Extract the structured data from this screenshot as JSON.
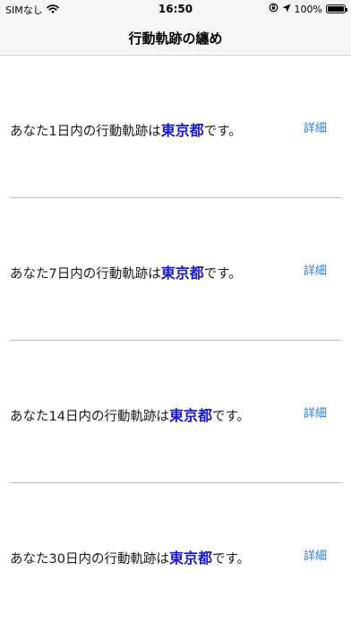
{
  "status_bar": {
    "carrier": "SIMなし",
    "time": "16:50",
    "battery": "100%",
    "battery_level": 1.0
  },
  "nav": {
    "title": "行動軌跡の纏め"
  },
  "rows": [
    {
      "prefix": "あなた1日内の行動軌跡は",
      "place": "東京都",
      "suffix": "です。",
      "detail": "詳細"
    },
    {
      "prefix": "あなた7日内の行動軌跡は",
      "place": "東京都",
      "suffix": "です。",
      "detail": "詳細"
    },
    {
      "prefix": "あなた14日内の行動軌跡は",
      "place": "東京都",
      "suffix": "です。",
      "detail": "詳細"
    },
    {
      "prefix": "あなた30日内の行動軌跡は",
      "place": "東京都",
      "suffix": "です。",
      "detail": "詳細"
    }
  ],
  "colors": {
    "place_text": "#1a1acc",
    "link": "#2f7cd6"
  },
  "icons": [
    "wifi-icon",
    "lock-rotation-icon",
    "location-arrow-icon",
    "battery-icon"
  ]
}
